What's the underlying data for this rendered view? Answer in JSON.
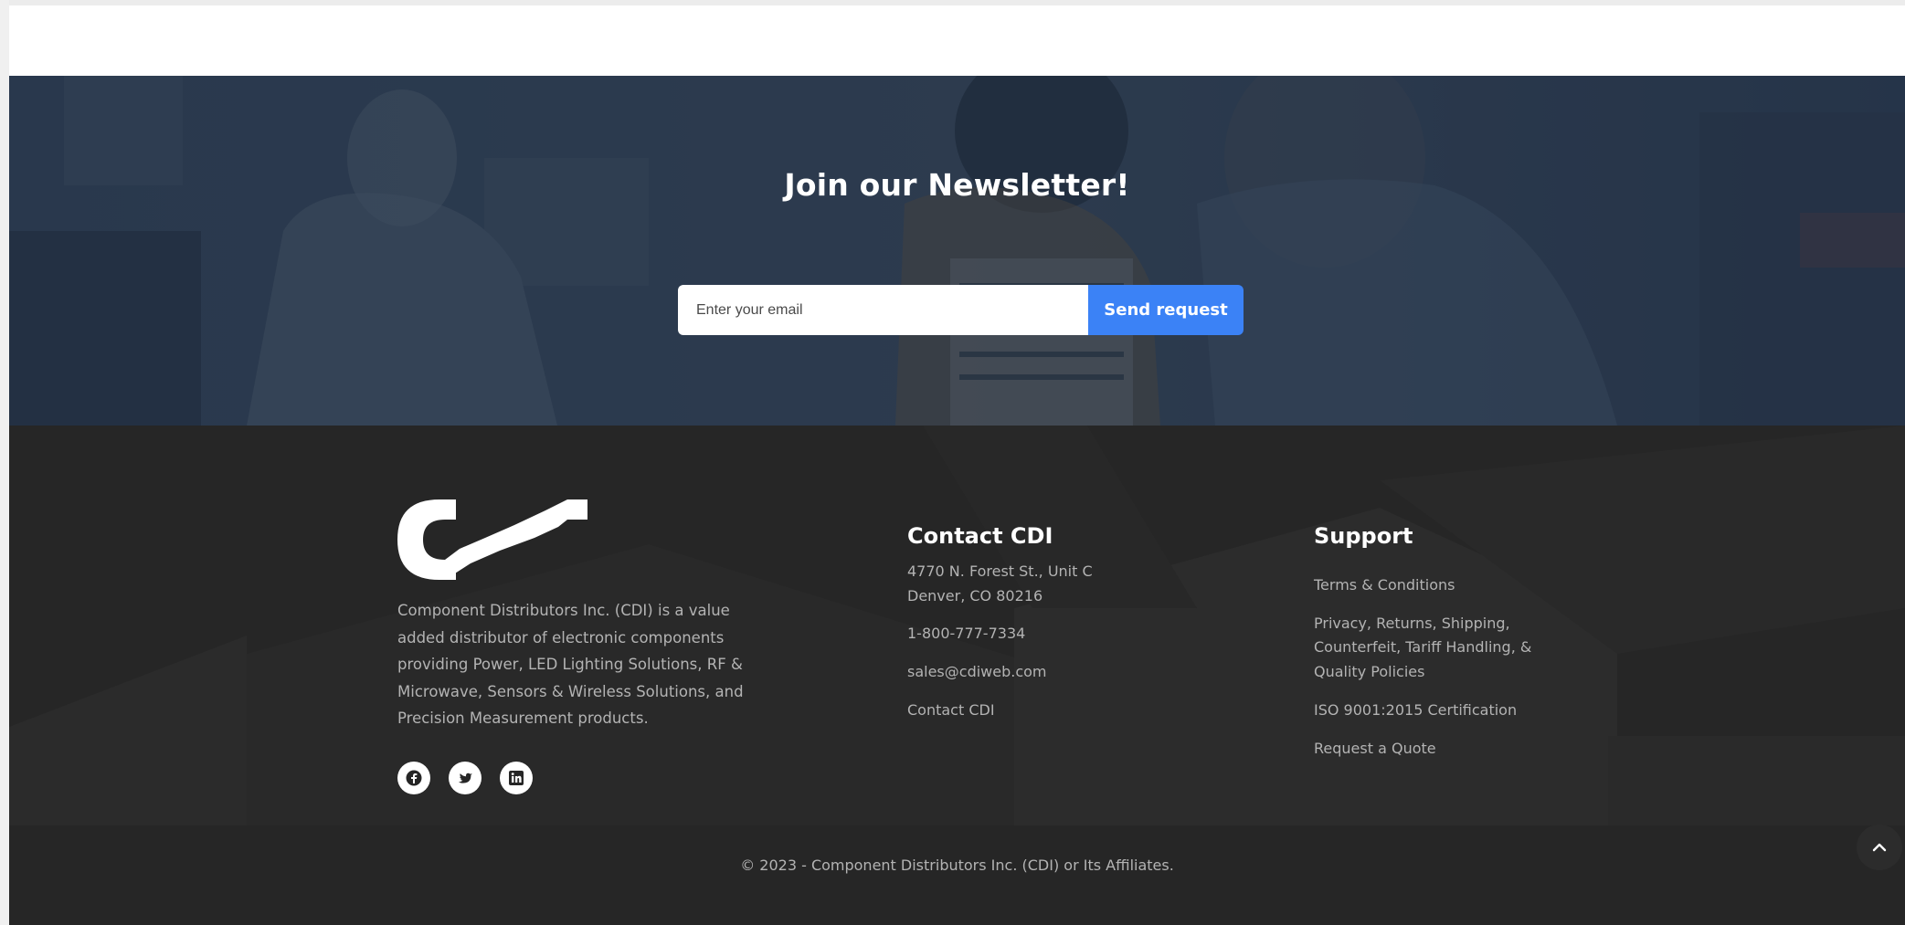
{
  "newsletter": {
    "title": "Join our Newsletter!",
    "email_placeholder": "Enter your email",
    "submit_label": "Send request",
    "button_color": "#3b82f6"
  },
  "footer": {
    "logo_name": "cdi-logo",
    "about": "Component Distributors Inc. (CDI) is a value added distributor of electronic components providing Power, LED Lighting Solutions, RF & Microwave, Sensors & Wireless Solutions, and Precision Measurement products.",
    "social": [
      {
        "icon": "facebook-icon"
      },
      {
        "icon": "twitter-icon"
      },
      {
        "icon": "linkedin-icon"
      }
    ],
    "contact": {
      "heading": "Contact CDI",
      "address_line1": "4770 N. Forest St., Unit C",
      "address_line2": "Denver, CO 80216",
      "phone": "1-800-777-7334",
      "email": "sales@cdiweb.com",
      "contact_link": "Contact CDI"
    },
    "support": {
      "heading": "Support",
      "links": [
        "Terms & Conditions",
        "Privacy, Returns, Shipping,",
        "Counterfeit, Tariff Handling, &",
        "Quality Policies",
        "ISO 9001:2015 Certification",
        "Request a Quote"
      ]
    },
    "copyright": "© 2023 - Component Distributors Inc. (CDI) or Its Affiliates.",
    "background_color": "#262626"
  }
}
